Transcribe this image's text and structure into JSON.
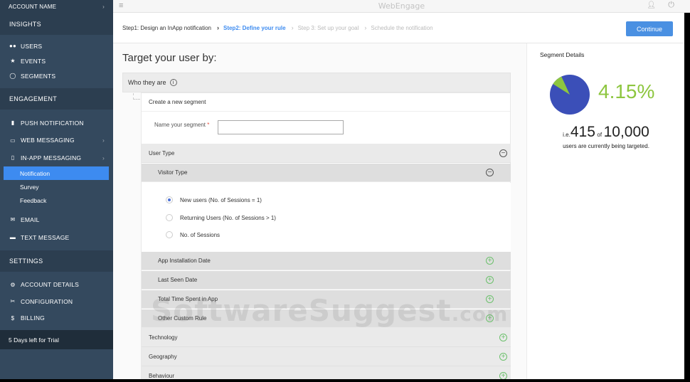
{
  "sidebar": {
    "account_name": "ACCOUNT NAME",
    "sections": {
      "insights": "INSIGHTS",
      "engagement": "ENGAGEMENT",
      "settings": "SETTINGS"
    },
    "insights_items": [
      {
        "label": "USERS",
        "icon": "users-icon"
      },
      {
        "label": "EVENTS",
        "icon": "star-icon"
      },
      {
        "label": "SEGMENTS",
        "icon": "segments-icon"
      }
    ],
    "engagement_items": [
      {
        "label": "PUSH NOTIFICATION",
        "icon": "push-icon"
      },
      {
        "label": "WEB MESSAGING",
        "icon": "web-icon"
      },
      {
        "label": "IN-APP MESSAGING",
        "icon": "mobile-icon"
      }
    ],
    "inapp_sub": [
      "Notification",
      "Survey",
      "Feedback"
    ],
    "channel_items": [
      {
        "label": "EMAIL",
        "icon": "email-icon"
      },
      {
        "label": "TEXT MESSAGE",
        "icon": "sms-icon"
      }
    ],
    "settings_items": [
      {
        "label": "ACCOUNT DETAILS",
        "icon": "gear-icon"
      },
      {
        "label": "CONFIGURATION",
        "icon": "tools-icon"
      },
      {
        "label": "BILLING",
        "icon": "dollar-icon"
      }
    ],
    "trial": "5 Days left for Trial"
  },
  "topbar": {
    "brand": "WebEngage"
  },
  "steps": {
    "step1": "Step1: Design an InApp notification",
    "step2": "Step2: Define your rule",
    "step3": "Step 3: Set up your goal",
    "step4": "Schedule  the notification",
    "continue": "Continue"
  },
  "main": {
    "title": "Target your user by:",
    "who_label": "Who they are",
    "segment_title": "Create a new segment",
    "name_label": "Name your segment",
    "name_value": "",
    "user_type": "User Type",
    "visitor_type": "Visitor Type",
    "radios": [
      {
        "label": "New users (No. of Sessions = 1)",
        "checked": true
      },
      {
        "label": "Returning Users   (No. of Sessions > 1)",
        "checked": false
      },
      {
        "label": "No. of Sessions",
        "checked": false
      }
    ],
    "sub_rules": [
      "App Installation Date",
      "Last Seen Date",
      "Total Time Spent in App",
      "Other Custom Rule"
    ],
    "top_rules": [
      "Technology",
      "Geography",
      "Behaviour"
    ]
  },
  "watermark": {
    "main": "SoftwareSuggest",
    "suffix": ".com"
  },
  "segment_details": {
    "title": "Segment Details",
    "percent": "4.15%",
    "percent_value": 4.15,
    "ie": "i.e.",
    "count": "415",
    "of": "of",
    "total": "10,000",
    "caption": "users are currently being targeted.",
    "colors": {
      "main": "#3b4fb8",
      "slice": "#8dc63f"
    }
  }
}
